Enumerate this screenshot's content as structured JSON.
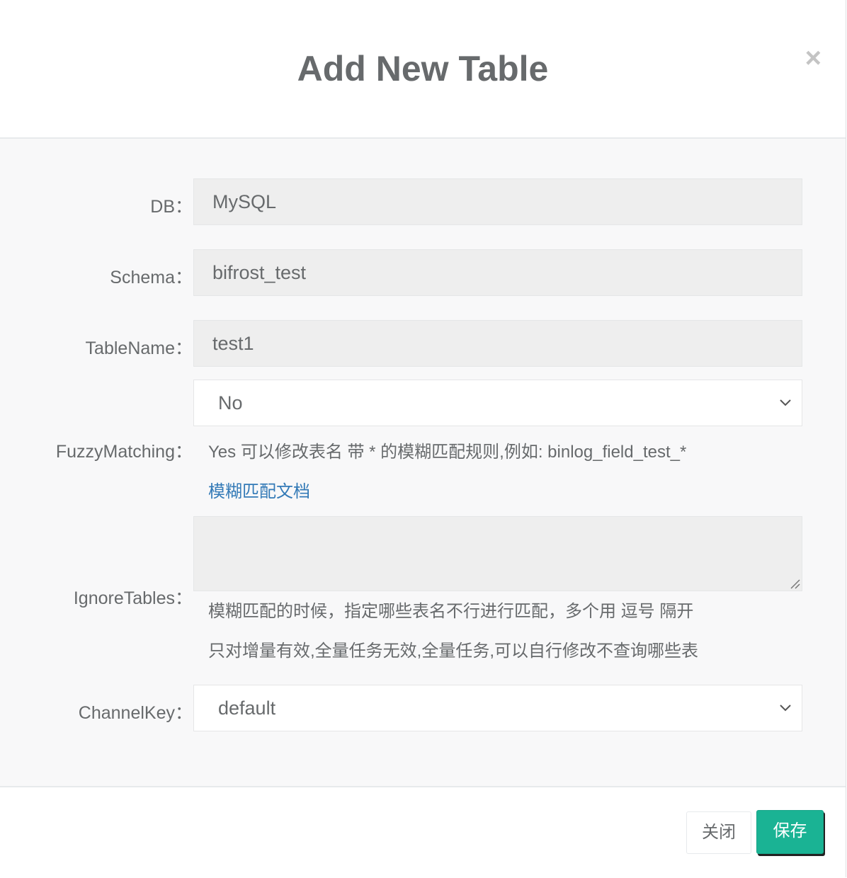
{
  "dialog": {
    "title": "Add New Table",
    "close_glyph": "×"
  },
  "form": {
    "db": {
      "label": "DB：",
      "value": "MySQL"
    },
    "schema": {
      "label": "Schema：",
      "value": "bifrost_test"
    },
    "table_name": {
      "label": "TableName：",
      "value": "test1"
    },
    "fuzzy_matching": {
      "label": "FuzzyMatching：",
      "selected": "No",
      "help": "Yes 可以修改表名 带 * 的模糊匹配规则,例如: binlog_field_test_*",
      "doc_link": "模糊匹配文档"
    },
    "ignore_tables": {
      "label": "IgnoreTables：",
      "value": "",
      "help_line1": "模糊匹配的时候，指定哪些表名不行进行匹配，多个用 逗号 隔开",
      "help_line2": "只对增量有效,全量任务无效,全量任务,可以自行修改不查询哪些表"
    },
    "channel_key": {
      "label": "ChannelKey：",
      "selected": "default"
    }
  },
  "footer": {
    "close_label": "关闭",
    "save_label": "保存"
  },
  "colors": {
    "primary": "#1ab394",
    "link": "#337ab7",
    "text": "#676a6c"
  }
}
